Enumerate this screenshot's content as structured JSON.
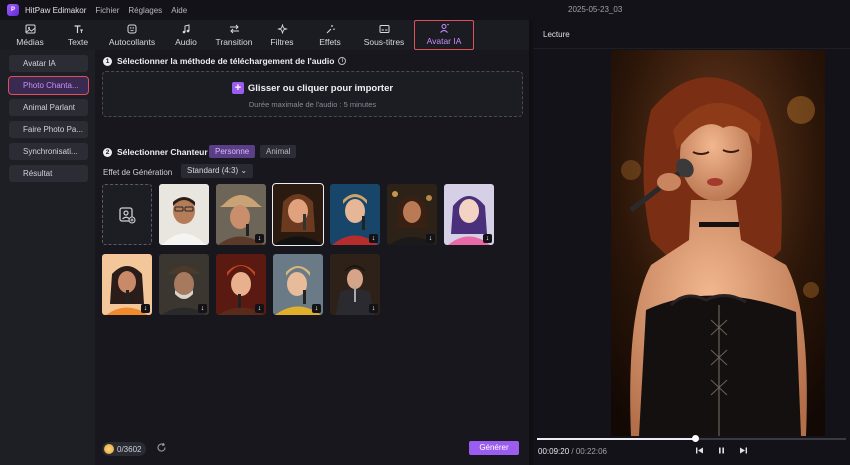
{
  "app": {
    "name": "HitPaw Edimakor",
    "logo_letter": "P"
  },
  "menu": [
    "Fichier",
    "Réglages",
    "Aide"
  ],
  "date": "2025-05-23_03",
  "tabs": [
    {
      "label": "Médias",
      "icon": "media-icon"
    },
    {
      "label": "Texte",
      "icon": "text-icon"
    },
    {
      "label": "Autocollants",
      "icon": "sticker-icon"
    },
    {
      "label": "Audio",
      "icon": "music-icon"
    },
    {
      "label": "Transition",
      "icon": "transition-icon"
    },
    {
      "label": "Filtres",
      "icon": "filter-icon"
    },
    {
      "label": "Effets",
      "icon": "effects-icon"
    },
    {
      "label": "Sous-titres",
      "icon": "subtitles-icon"
    },
    {
      "label": "Avatar IA",
      "icon": "avatar-ai-icon",
      "active": true
    }
  ],
  "sidebar": [
    {
      "label": "Avatar IA"
    },
    {
      "label": "Photo Chanta...",
      "active": true
    },
    {
      "label": "Animal Parlant"
    },
    {
      "label": "Faire Photo Pa..."
    },
    {
      "label": "Synchronisati..."
    },
    {
      "label": "Résultat"
    }
  ],
  "step1": {
    "num": "1",
    "title": "Sélectionner la méthode de téléchargement de l'audio",
    "info": "i"
  },
  "upload": {
    "main": "Glisser ou cliquer pour importer",
    "sub": "Durée maximale de l'audio : 5 minutes",
    "plus": "+"
  },
  "step2": {
    "num": "2",
    "title": "Sélectionner Chanteur"
  },
  "singer_filters": {
    "person": "Personne",
    "animal": "Animal"
  },
  "effect": {
    "label": "Effet de Génération",
    "value": "Standard (4:3)",
    "chevron": "⌄"
  },
  "download_glyph": "↓",
  "footer": {
    "credits": "0/3602",
    "generate": "Générer"
  },
  "player": {
    "title": "Lecture",
    "current": "00:09:20",
    "total": "00:22:06",
    "separator": "/",
    "progress": 0.51
  },
  "colors": {
    "accent": "#9b5cf0",
    "highlight": "#e0505a",
    "active_text": "#c98dff"
  }
}
